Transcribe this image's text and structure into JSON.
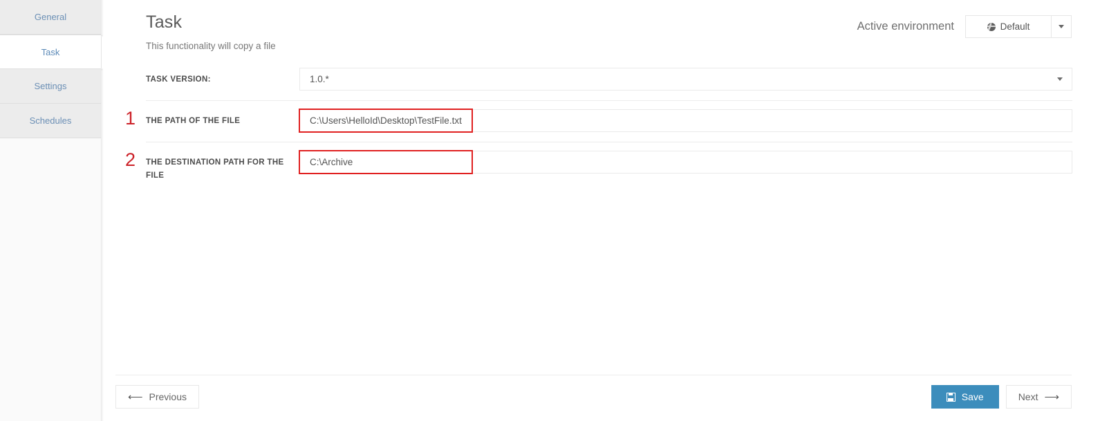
{
  "sidebar": {
    "items": [
      {
        "label": "General",
        "active": false
      },
      {
        "label": "Task",
        "active": true
      },
      {
        "label": "Settings",
        "active": false
      },
      {
        "label": "Schedules",
        "active": false
      }
    ]
  },
  "header": {
    "title": "Task",
    "subtitle": "This functionality will copy a file",
    "environment_label": "Active environment",
    "environment_value": "Default",
    "environment_icon": "globe-icon",
    "environment_caret_icon": "chevron-down-icon"
  },
  "form": {
    "version": {
      "label": "TASK VERSION:",
      "value": "1.0.*",
      "caret_icon": "chevron-down-icon"
    },
    "fields": [
      {
        "marker": "1",
        "label": "THE PATH OF THE FILE",
        "value": "C:\\Users\\HelloId\\Desktop\\TestFile.txt",
        "placeholder": ""
      },
      {
        "marker": "2",
        "label": "THE DESTINATION PATH FOR THE FILE",
        "value": "C:\\Archive",
        "placeholder": ""
      }
    ]
  },
  "footer": {
    "previous_label": "Previous",
    "previous_icon": "arrow-left-icon",
    "save_label": "Save",
    "save_icon": "floppy-disk-icon",
    "next_label": "Next",
    "next_icon": "arrow-right-icon"
  },
  "colors": {
    "primary": "#3c8dbc",
    "annotation_red": "#e02020",
    "marker_red": "#cc2128",
    "nav_link": "#6b8fb5"
  }
}
